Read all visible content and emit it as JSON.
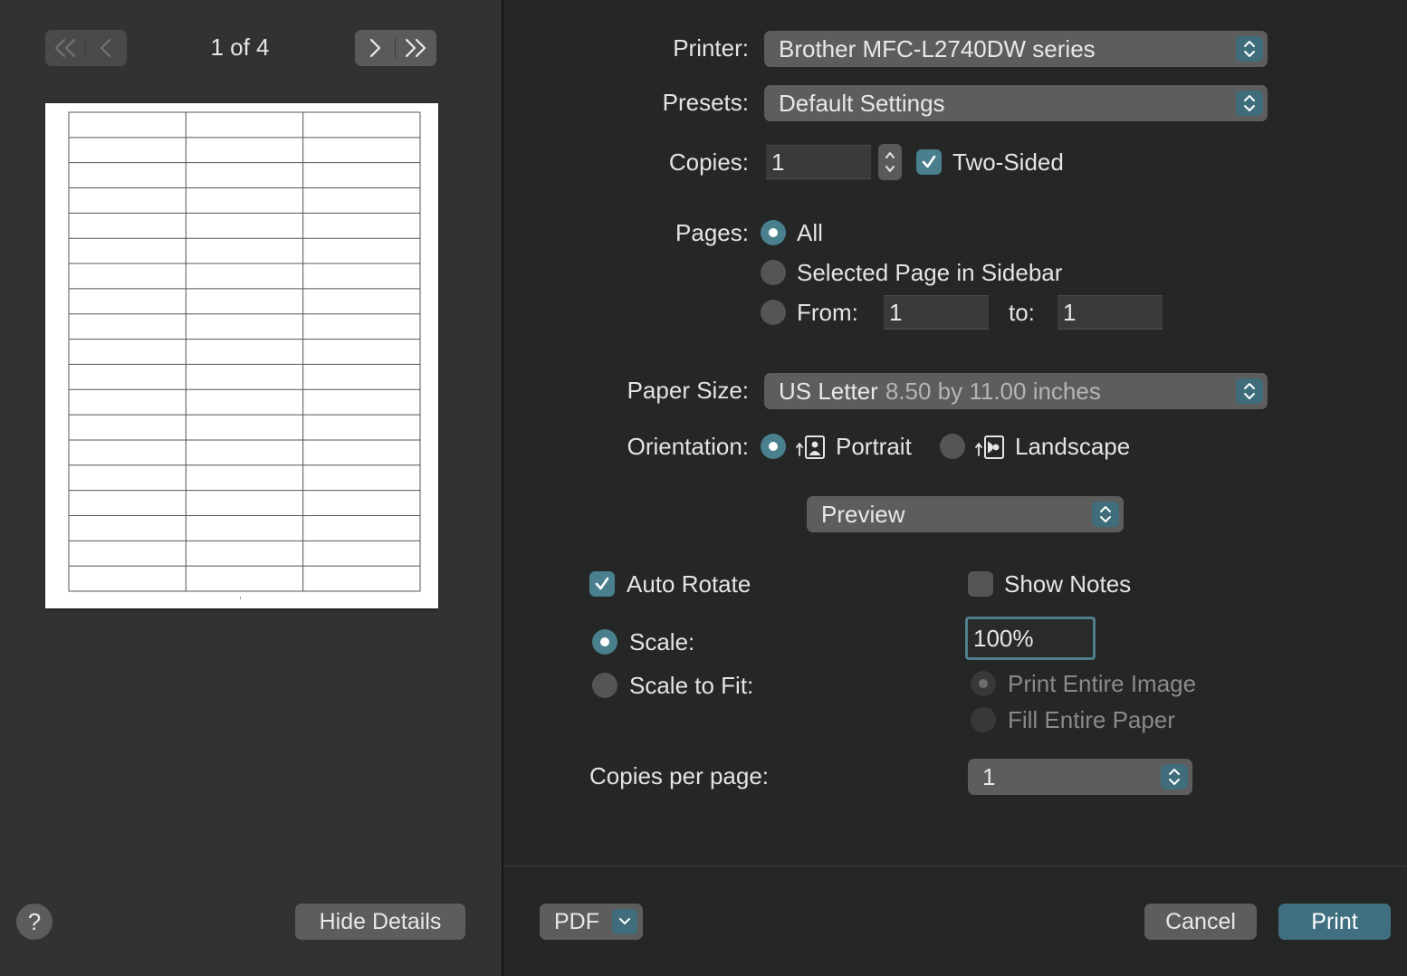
{
  "sidebar": {
    "page_indicator": "1 of 4",
    "help_label": "?",
    "hide_details_label": "Hide Details"
  },
  "form": {
    "printer": {
      "label": "Printer:",
      "value": "Brother MFC-L2740DW series"
    },
    "presets": {
      "label": "Presets:",
      "value": "Default Settings"
    },
    "copies": {
      "label": "Copies:",
      "value": "1",
      "two_sided_label": "Two-Sided",
      "two_sided": true
    },
    "pages": {
      "label": "Pages:",
      "all_label": "All",
      "selected_label": "Selected Page in Sidebar",
      "from_label": "From:",
      "from_value": "1",
      "to_label": "to:",
      "to_value": "1",
      "selected_option": "All"
    },
    "paper_size": {
      "label": "Paper Size:",
      "value": "US Letter",
      "detail": "8.50 by 11.00 inches"
    },
    "orientation": {
      "label": "Orientation:",
      "portrait_label": "Portrait",
      "landscape_label": "Landscape",
      "selected": "Portrait"
    },
    "section_popup": "Preview",
    "auto_rotate": {
      "label": "Auto Rotate",
      "checked": true
    },
    "show_notes": {
      "label": "Show Notes",
      "checked": false
    },
    "scale": {
      "label": "Scale:",
      "value": "100%",
      "selected": true
    },
    "scale_to_fit": {
      "label": "Scale to Fit:",
      "print_entire_image_label": "Print Entire Image",
      "fill_entire_paper_label": "Fill Entire Paper",
      "selected_sub_option": "Print Entire Image"
    },
    "copies_per_page": {
      "label": "Copies per page:",
      "value": "1"
    }
  },
  "footer": {
    "pdf_label": "PDF",
    "cancel_label": "Cancel",
    "print_label": "Print"
  },
  "colors": {
    "accent": "#4a7f8e",
    "sidebar_bg": "#323232",
    "main_bg": "#252626"
  }
}
